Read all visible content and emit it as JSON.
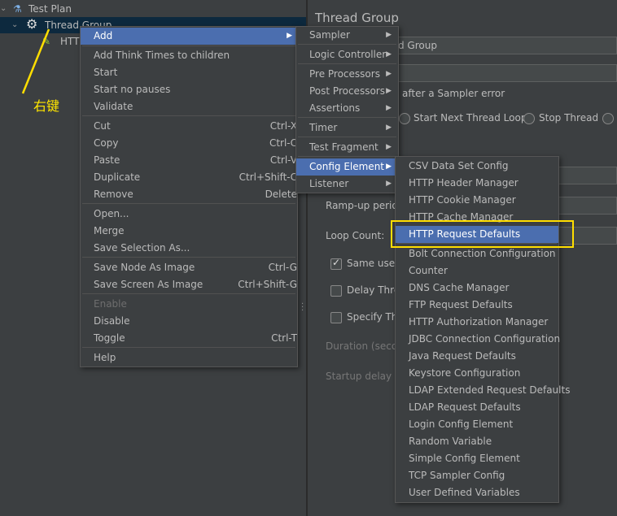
{
  "tree": {
    "test_plan": "Test Plan",
    "thread_group": "Thread Group",
    "http_child": "HTTI"
  },
  "annotation": {
    "right_click": "右键"
  },
  "panel": {
    "title": "Thread Group",
    "name_value": "d Group",
    "action_label": "after a Sampler error",
    "radio_next_loop": "Start Next Thread Loop",
    "radio_stop_thread": "Stop Thread",
    "ramp_up": "Ramp-up perioc",
    "loop_count": "Loop Count:",
    "same_user": "Same user c",
    "delay_thread": "Delay Threa",
    "specify_thread": "Specify Thr",
    "duration": "Duration (secon",
    "startup_delay": "Startup delay (se"
  },
  "context_menu": {
    "items": [
      {
        "label": "Add",
        "shortcut": "",
        "submenu": true
      },
      {
        "label": "Add Think Times to children",
        "shortcut": ""
      },
      {
        "label": "Start",
        "shortcut": ""
      },
      {
        "label": "Start no pauses",
        "shortcut": ""
      },
      {
        "label": "Validate",
        "shortcut": ""
      },
      {
        "label": "Cut",
        "shortcut": "Ctrl-X"
      },
      {
        "label": "Copy",
        "shortcut": "Ctrl-C"
      },
      {
        "label": "Paste",
        "shortcut": "Ctrl-V"
      },
      {
        "label": "Duplicate",
        "shortcut": "Ctrl+Shift-C"
      },
      {
        "label": "Remove",
        "shortcut": "Delete"
      },
      {
        "label": "Open...",
        "shortcut": ""
      },
      {
        "label": "Merge",
        "shortcut": ""
      },
      {
        "label": "Save Selection As...",
        "shortcut": ""
      },
      {
        "label": "Save Node As Image",
        "shortcut": "Ctrl-G"
      },
      {
        "label": "Save Screen As Image",
        "shortcut": "Ctrl+Shift-G"
      },
      {
        "label": "Enable",
        "shortcut": ""
      },
      {
        "label": "Disable",
        "shortcut": ""
      },
      {
        "label": "Toggle",
        "shortcut": "Ctrl-T"
      },
      {
        "label": "Help",
        "shortcut": ""
      }
    ]
  },
  "add_menu": {
    "items": [
      {
        "label": "Sampler"
      },
      {
        "label": "Logic Controller"
      },
      {
        "label": "Pre Processors"
      },
      {
        "label": "Post Processors"
      },
      {
        "label": "Assertions"
      },
      {
        "label": "Timer"
      },
      {
        "label": "Test Fragment"
      },
      {
        "label": "Config Element"
      },
      {
        "label": "Listener"
      }
    ]
  },
  "config_menu": {
    "items": [
      {
        "label": "CSV Data Set Config"
      },
      {
        "label": "HTTP Header Manager"
      },
      {
        "label": "HTTP Cookie Manager"
      },
      {
        "label": "HTTP Cache Manager"
      },
      {
        "label": "HTTP Request Defaults"
      },
      {
        "label": "Bolt Connection Configuration"
      },
      {
        "label": "Counter"
      },
      {
        "label": "DNS Cache Manager"
      },
      {
        "label": "FTP Request Defaults"
      },
      {
        "label": "HTTP Authorization Manager"
      },
      {
        "label": "JDBC Connection Configuration"
      },
      {
        "label": "Java Request Defaults"
      },
      {
        "label": "Keystore Configuration"
      },
      {
        "label": "LDAP Extended Request Defaults"
      },
      {
        "label": "LDAP Request Defaults"
      },
      {
        "label": "Login Config Element"
      },
      {
        "label": "Random Variable"
      },
      {
        "label": "Simple Config Element"
      },
      {
        "label": "TCP Sampler Config"
      },
      {
        "label": "User Defined Variables"
      }
    ]
  },
  "colors": {
    "background": "#3c3f41",
    "highlight": "#4b6eaf",
    "annotation": "#ffde00"
  }
}
